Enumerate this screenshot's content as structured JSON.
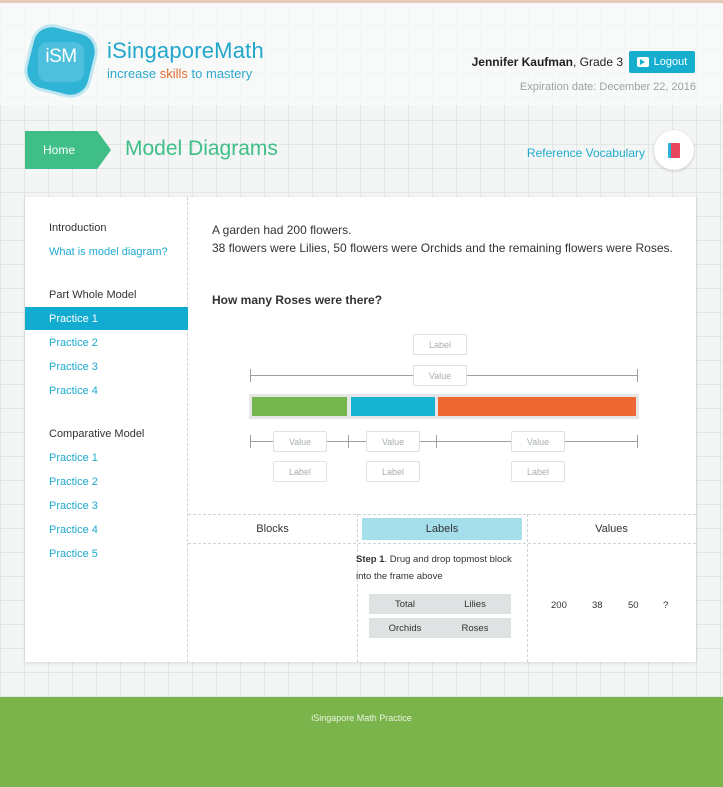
{
  "brand": {
    "mark": "iSM",
    "name": "iSingaporeMath",
    "tag_pre": "increase ",
    "tag_skills": "skills",
    "tag_post": " to mastery"
  },
  "user": {
    "name": "Jennifer Kaufman",
    "grade": ", Grade 3",
    "logout_label": "Logout",
    "expiry": "Expiration date: December 22, 2016"
  },
  "nav": {
    "home_label": "Home",
    "page_title": "Model Diagrams",
    "reference_label": "Reference Vocabulary"
  },
  "sidebar": {
    "intro_heading": "Introduction",
    "intro_link": "What is model diagram?",
    "part_whole_heading": "Part Whole Model",
    "part_whole_items": [
      "Practice 1",
      "Practice 2",
      "Practice 3",
      "Practice 4"
    ],
    "comparative_heading": "Comparative Model",
    "comparative_items": [
      "Practice 1",
      "Practice 2",
      "Practice 3",
      "Practice 4",
      "Practice 5"
    ]
  },
  "question": {
    "line1": "A garden had 200 flowers.",
    "line2": "38 flowers were Lilies, 50 flowers were Orchids and the remaining flowers were Roses.",
    "ask": "How many Roses were there?"
  },
  "diagram": {
    "top_label": "Label",
    "total_value": "Value",
    "segment_values": [
      "Value",
      "Value",
      "Value"
    ],
    "segment_labels": [
      "Label",
      "Label",
      "Label"
    ],
    "bar_colors": [
      "#74b64d",
      "#17b3d2",
      "#ed6833"
    ]
  },
  "panel": {
    "blocks_header": "Blocks",
    "labels_header": "Labels",
    "values_header": "Values",
    "step_bold": "Step 1",
    "step_text": ". Drug and drop topmost block into the frame above",
    "label_chips": [
      "Total",
      "Lilies",
      "Orchids",
      "Roses"
    ],
    "values": [
      "200",
      "38",
      "50",
      "?"
    ]
  },
  "footer": {
    "text": "iSingapore Math Practice"
  }
}
